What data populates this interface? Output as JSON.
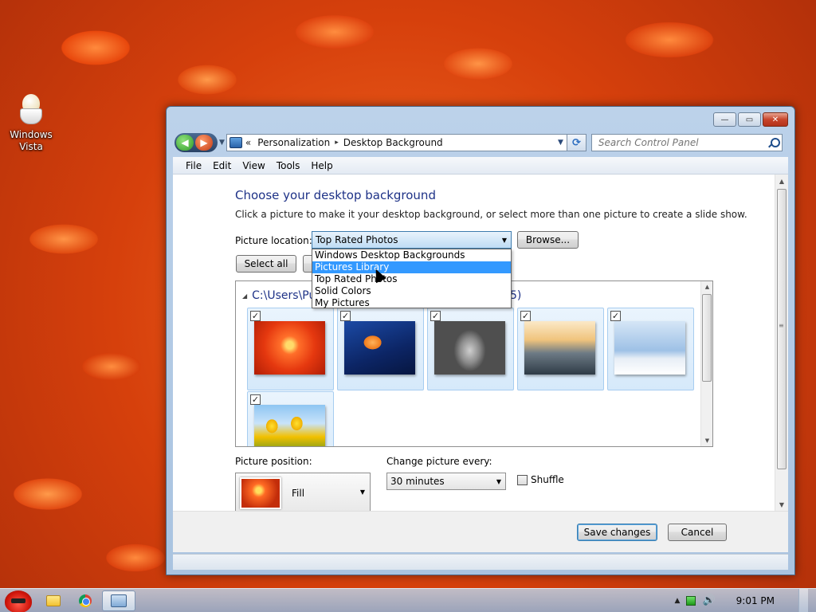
{
  "desktop": {
    "icon_label": "Windows Vista"
  },
  "window": {
    "controls": {
      "minimize": "—",
      "maximize": "▭",
      "close": "✕"
    }
  },
  "address_bar": {
    "chevron": "«",
    "crumbs": [
      "Personalization",
      "Desktop Background"
    ],
    "separator": "▸"
  },
  "search": {
    "placeholder": "Search Control Panel"
  },
  "menu": [
    "File",
    "Edit",
    "View",
    "Tools",
    "Help"
  ],
  "page": {
    "title": "Choose your desktop background",
    "subtitle": "Click a picture to make it your desktop background, or select more than one picture to create a slide show.",
    "location_label": "Picture location:",
    "location_value": "Top Rated Photos",
    "browse_label": "Browse...",
    "select_all_label": "Select all",
    "dropdown_options": [
      "Windows Desktop Backgrounds",
      "Pictures Library",
      "Top Rated Photos",
      "Solid Colors",
      "My Pictures"
    ],
    "dropdown_selected_index": 1,
    "group_path": "C:\\Users\\Pu",
    "group_count_suffix": "5)",
    "pictures": [
      {
        "icon": "dahlia-photo",
        "checked": "✓"
      },
      {
        "icon": "jellyfish-photo",
        "checked": "✓"
      },
      {
        "icon": "koala-photo",
        "checked": "✓"
      },
      {
        "icon": "lighthouse-photo",
        "checked": "✓"
      },
      {
        "icon": "penguins-photo",
        "checked": "✓"
      },
      {
        "icon": "tulips-photo",
        "checked": "✓"
      }
    ],
    "position_label": "Picture position:",
    "position_value": "Fill",
    "change_label": "Change picture every:",
    "interval_value": "30 minutes",
    "shuffle_label": "Shuffle"
  },
  "footer": {
    "save_label": "Save changes",
    "cancel_label": "Cancel"
  },
  "taskbar": {
    "clock": "9:01 PM"
  },
  "colors": {
    "title_blue": "#1e3287",
    "selection_blue": "#3399ff",
    "close_red": "#c7452c"
  }
}
